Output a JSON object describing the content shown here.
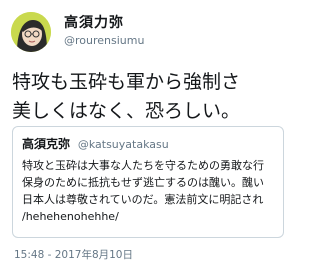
{
  "author": {
    "name": "高須力弥",
    "handle": "@rourensiumu"
  },
  "tweet": {
    "lines": [
      "特攻も玉砕も軍から強制さ",
      "美しくはなく、恐ろしい。"
    ]
  },
  "quoted": {
    "name": "高須克弥",
    "handle": "@katsuyatakasu",
    "lines": [
      "特攻と玉砕は大事な人たちを守るための勇敢な行",
      "保身のために抵抗もせず逃亡するのは醜い。醜い",
      "日本人は尊敬されていのだ。憲法前文に明記され",
      "/hehehenohehhe/"
    ]
  },
  "timestamp": "15:48 - 2017年8月10日",
  "colors": {
    "avatar": "#c9d94e",
    "secondary_text": "#657786",
    "border": "#ccd6dd"
  }
}
